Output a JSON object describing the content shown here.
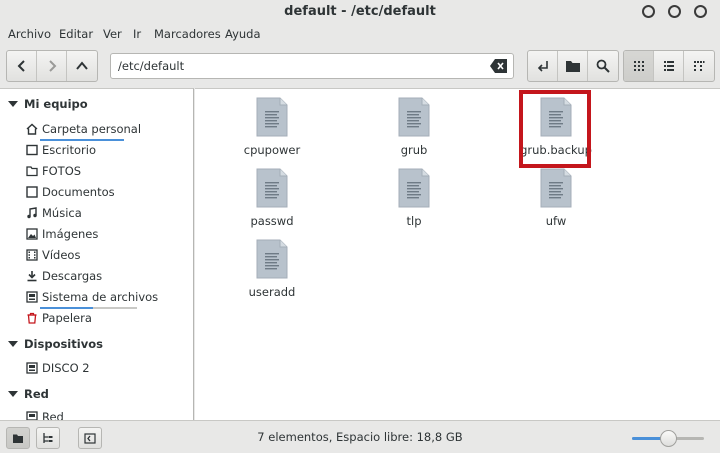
{
  "window": {
    "title": "default - /etc/default"
  },
  "menu": [
    "Archivo",
    "Editar",
    "Ver",
    "Ir",
    "Marcadores",
    "Ayuda"
  ],
  "location": {
    "path": "/etc/default"
  },
  "sidebar": {
    "sections": [
      {
        "title": "Mi equipo",
        "items": [
          {
            "label": "Carpeta personal",
            "icon": "home-icon",
            "underline": true
          },
          {
            "label": "Escritorio",
            "icon": "desktop-icon"
          },
          {
            "label": "FOTOS",
            "icon": "folder-icon"
          },
          {
            "label": "Documentos",
            "icon": "documents-icon"
          },
          {
            "label": "Música",
            "icon": "music-icon"
          },
          {
            "label": "Imágenes",
            "icon": "pictures-icon"
          },
          {
            "label": "Vídeos",
            "icon": "videos-icon"
          },
          {
            "label": "Descargas",
            "icon": "downloads-icon"
          },
          {
            "label": "Sistema de archivos",
            "icon": "filesystem-icon",
            "usage": 0.55
          },
          {
            "label": "Papelera",
            "icon": "trash-icon"
          }
        ]
      },
      {
        "title": "Dispositivos",
        "items": [
          {
            "label": "DISCO 2",
            "icon": "drive-icon"
          }
        ]
      },
      {
        "title": "Red",
        "items": [
          {
            "label": "Red",
            "icon": "network-icon"
          }
        ]
      }
    ]
  },
  "files": [
    "cpupower",
    "grub",
    "grub.backup",
    "passwd",
    "tlp",
    "ufw",
    "useradd"
  ],
  "highlighted_file": "grub.backup",
  "status": {
    "text": "7 elementos, Espacio libre: 18,8 GB"
  },
  "zoom": {
    "level": 0.5
  },
  "colors": {
    "accent": "#4a90d9",
    "highlight": "#c4161c"
  }
}
